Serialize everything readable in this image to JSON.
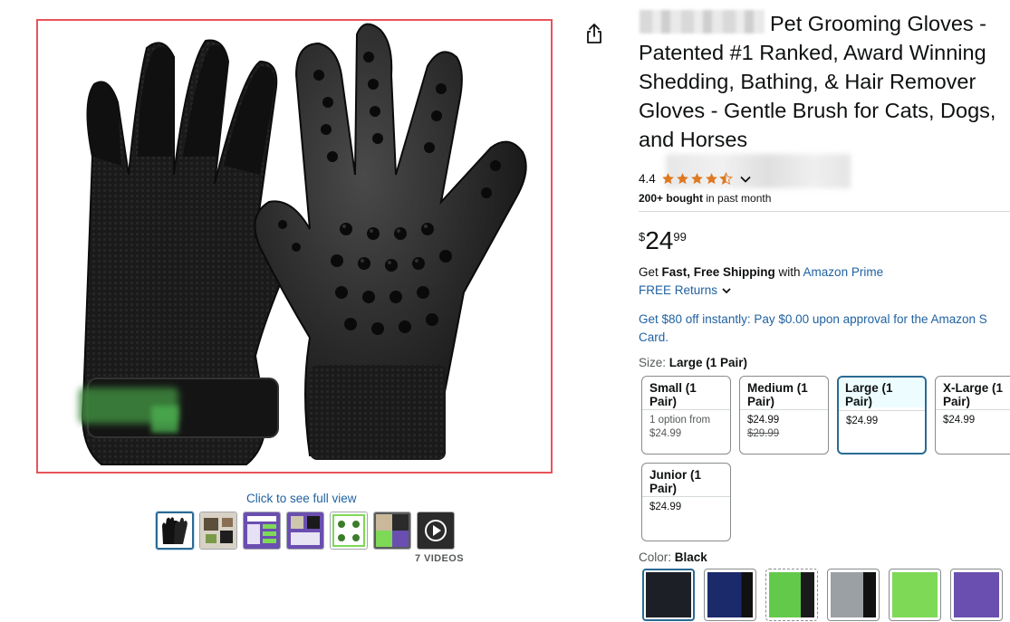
{
  "product": {
    "title": "Pet Grooming Gloves - Patented #1 Ranked, Award Winning Shedding, Bathing, & Hair Remover Gloves - Gentle Brush for Cats, Dogs, and Horses",
    "see_full_view": "Click to see full view",
    "videos_label": "7 VIDEOS",
    "thumbnails": [
      "glove-photo",
      "lifestyle",
      "size-chart",
      "features",
      "benefits",
      "usage",
      "video"
    ],
    "share_icon": "share-icon"
  },
  "rating": {
    "value": "4.4",
    "stars": 4.4,
    "bought": "200+ bought",
    "bought_suffix": " in past month"
  },
  "price": {
    "symbol": "$",
    "whole": "24",
    "fraction": "99"
  },
  "shipping": {
    "prefix": "Get ",
    "fast_free": "Fast, Free Shipping",
    "with": " with ",
    "prime_link": "Amazon Prime",
    "returns": "FREE Returns",
    "promo": "Get $80 off instantly: Pay $0.00 upon approval for the Amazon S",
    "promo_cont": "Card."
  },
  "size": {
    "label": "Size: ",
    "selected": "Large (1 Pair)",
    "options": [
      {
        "name": "Small (1 Pair)",
        "line1": "1 option from",
        "line2": "$24.99"
      },
      {
        "name": "Medium (1 Pair)",
        "line1": "$24.99",
        "line2": "$29.99"
      },
      {
        "name": "Large (1 Pair)",
        "line1": "$24.99",
        "line2": ""
      },
      {
        "name": "X-Large (1 Pair)",
        "line1": "$24.99",
        "line2": ""
      },
      {
        "name": "Junior (1 Pair)",
        "line1": "$24.99",
        "line2": ""
      }
    ]
  },
  "color": {
    "label": "Color: ",
    "selected": "Black",
    "swatches": [
      "#1c1f26",
      "#1b2a6b",
      "#63c94a",
      "#9aa0a3",
      "#7ed957",
      "#6a4fb0"
    ]
  }
}
